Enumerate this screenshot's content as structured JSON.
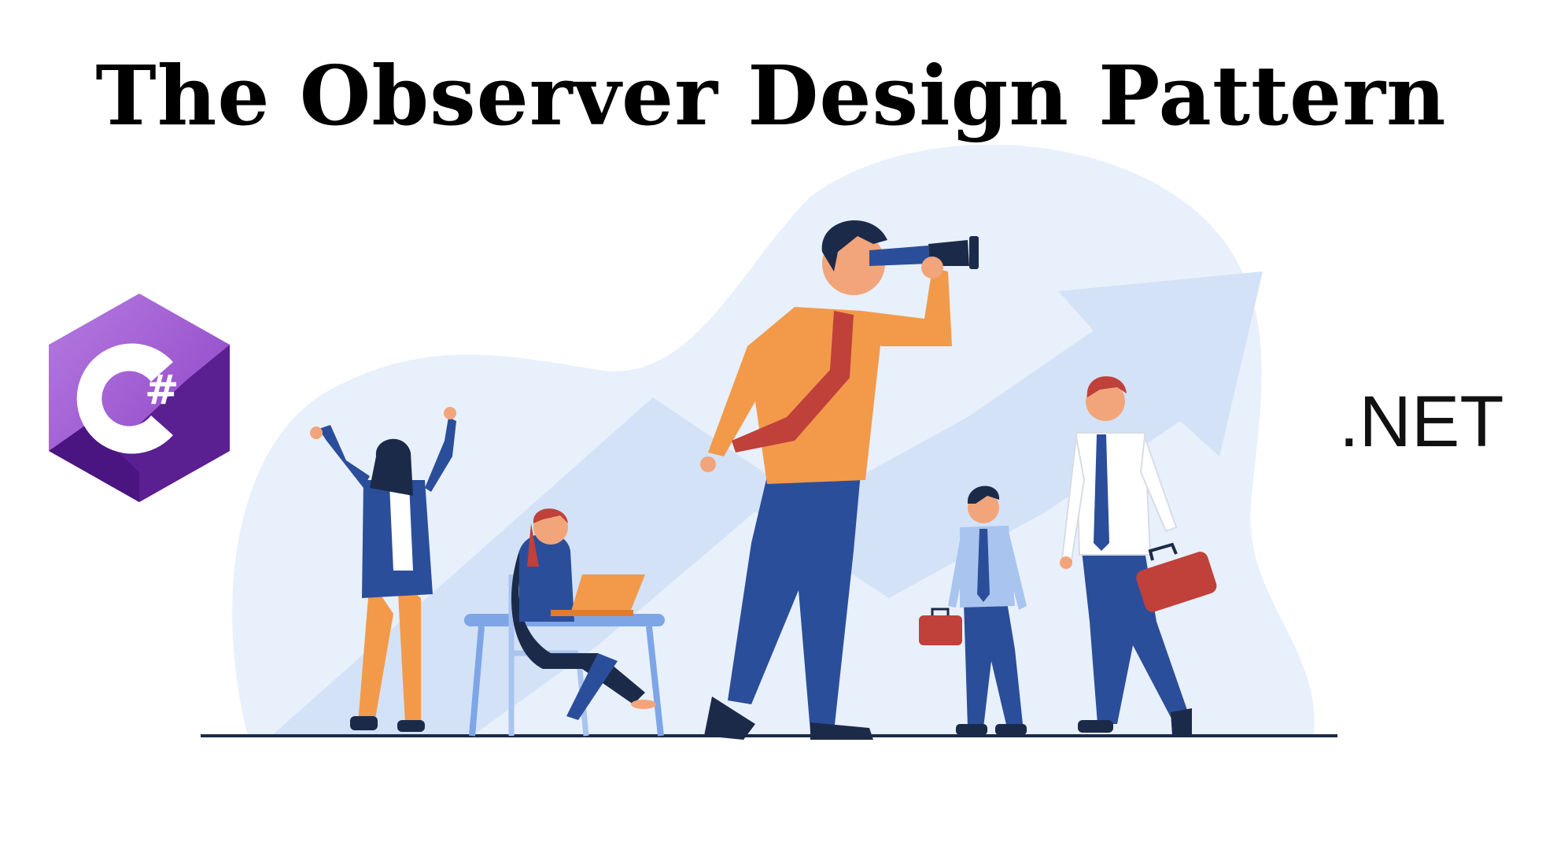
{
  "title": "The Observer Design Pattern",
  "logos": {
    "csharp": {
      "glyph": "#",
      "icon": "csharp-hexagon-logo",
      "colors": [
        "#9b4fd0",
        "#68217a",
        "#4a1a86"
      ]
    },
    "dotnet": {
      "text": ".NET"
    }
  },
  "illustration": {
    "icons": [
      "telescope-icon",
      "laptop-icon",
      "briefcase-icon",
      "trend-arrow-icon"
    ],
    "colors": {
      "blob": "#e8f0fb",
      "arrow": "#d3e2f7",
      "navy": "#2b4e9a",
      "orange": "#f29a4a",
      "red": "#c0403a",
      "floor": "#1c2a4a"
    }
  }
}
